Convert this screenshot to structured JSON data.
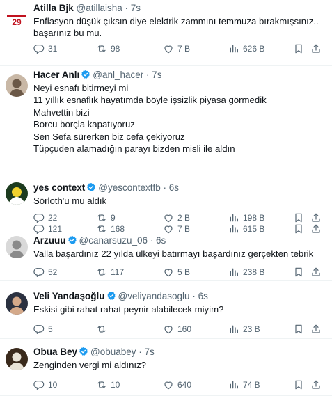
{
  "tweets": [
    {
      "name": "Atilla Bjk",
      "handle": "@atillaisha",
      "time": "7s",
      "verified": false,
      "avatar": {
        "bg": "#ffffff",
        "fg": "#c1121f",
        "text": "29"
      },
      "lines": [
        "Enflasyon düşük çıksın diye elektrik zammını temmuza bırakmışsınız..",
        "başarınız bu mu."
      ],
      "reply": "31",
      "retweet": "98",
      "like": "7 B",
      "views": "626 B"
    },
    {
      "name": "Hacer Anlı",
      "handle": "@anl_hacer",
      "time": "7s",
      "verified": true,
      "avatar": {
        "bg": "#c9b8a6",
        "fg": "#6b5847"
      },
      "lines": [
        "Neyi esnafı bitirmeyi mi",
        "11 yıllık esnaflık hayatımda böyle işsizlik piyasa görmedik",
        "Mahvettin bizi",
        "Borcu borçla kapatıyoruz",
        "Sen Sefa sürerken biz cefa çekiyoruz",
        "Tüpçuden alamadığın parayı bizden misli ile aldın"
      ],
      "reply": "121",
      "retweet": "168",
      "like": "7 B",
      "views": "615 B"
    },
    {
      "name": "yes context",
      "handle": "@yescontextfb",
      "time": "6s",
      "verified": true,
      "avatar": {
        "bg": "#1d3b1f",
        "fg": "#f2d22e"
      },
      "lines": [
        "Sörloth'u mu aldık"
      ],
      "reply": "22",
      "retweet": "9",
      "like": "2 B",
      "views": "198 B"
    },
    {
      "name": "Arzuuu",
      "handle": "@canarsuzu_06",
      "time": "6s",
      "verified": true,
      "avatar": {
        "bg": "#d9d9d9",
        "fg": "#8a8a8a"
      },
      "lines": [
        "Valla başardınız 22 yılda ülkeyi batırmayı başardınız gerçekten tebrik"
      ],
      "reply": "52",
      "retweet": "117",
      "like": "5 B",
      "views": "238 B"
    },
    {
      "name": "Veli Yandaşoğlu",
      "handle": "@veliyandasoglu",
      "time": "6s",
      "verified": true,
      "avatar": {
        "bg": "#2b3140",
        "fg": "#d4a98a"
      },
      "lines": [
        "Eskisi gibi rahat rahat peynir alabilecek miyim?"
      ],
      "reply": "5",
      "retweet": "",
      "like": "160",
      "views": "23 B"
    },
    {
      "name": "Obua Bey",
      "handle": "@obuabey",
      "time": "7s",
      "verified": true,
      "avatar": {
        "bg": "#3a2a1c",
        "fg": "#e9e3d6"
      },
      "lines": [
        "Zenginden vergi mi aldınız?"
      ],
      "reply": "10",
      "retweet": "10",
      "like": "640",
      "views": "74 B"
    }
  ],
  "colors": {
    "text": "#0f1419",
    "muted": "#536471",
    "verified": "#1d9bf0",
    "divider": "#eff3f4"
  },
  "icons": [
    "reply-icon",
    "retweet-icon",
    "like-icon",
    "views-icon",
    "bookmark-icon",
    "share-icon",
    "verified-badge-icon"
  ]
}
